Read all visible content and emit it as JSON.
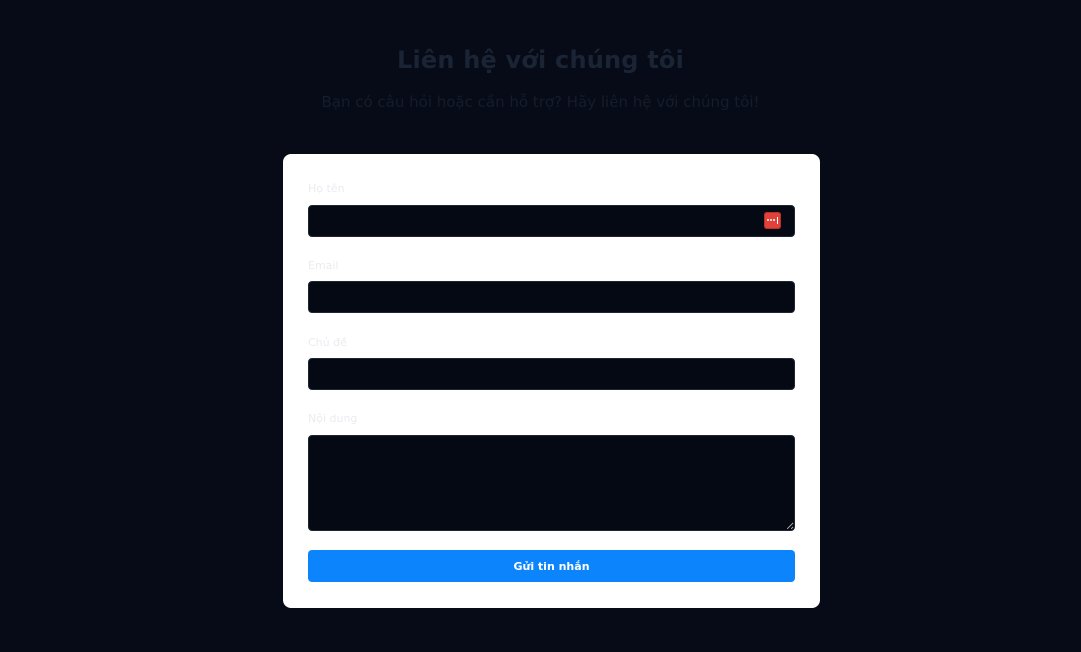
{
  "header": {
    "title": "Liên hệ với chúng tôi",
    "subtitle": "Bạn có câu hỏi hoặc cần hỗ trợ? Hãy liên hệ với chúng tôi!"
  },
  "form": {
    "fields": [
      {
        "label": "Họ tên",
        "value": "",
        "type": "text"
      },
      {
        "label": "Email",
        "value": "",
        "type": "email"
      },
      {
        "label": "Chủ đề",
        "value": "",
        "type": "text"
      },
      {
        "label": "Nội dung",
        "value": "",
        "type": "textarea"
      }
    ],
    "password_manager_icon": "password-manager-icon",
    "submit_label": "Gửi tin nhắn"
  },
  "colors": {
    "background": "#060b17",
    "card": "#ffffff",
    "input_background": "#050913",
    "submit_button": "#0b84fc",
    "password_manager_icon": "#e0413a"
  }
}
